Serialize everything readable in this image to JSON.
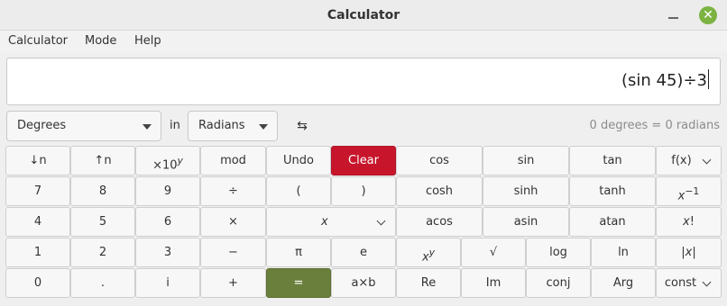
{
  "window": {
    "title": "Calculator",
    "close_glyph": "✕"
  },
  "menu": {
    "items": [
      "Calculator",
      "Mode",
      "Help"
    ]
  },
  "display": {
    "expression": "(sin 45)÷3"
  },
  "conversion": {
    "from_unit": "Degrees",
    "in_label": "in",
    "to_unit": "Radians",
    "swap_glyph": "⇆",
    "result": "0 degrees = 0 radians"
  },
  "keys": {
    "down_n": "↓n",
    "up_n": "↑n",
    "exp10_base": "×10",
    "exp10_sup": "y",
    "mod": "mod",
    "undo": "Undo",
    "clear": "Clear",
    "cos": "cos",
    "sin": "sin",
    "tan": "tan",
    "fx": "f(x)",
    "d7": "7",
    "d8": "8",
    "d9": "9",
    "divide": "÷",
    "lparen": "(",
    "rparen": ")",
    "cosh": "cosh",
    "sinh": "sinh",
    "tanh": "tanh",
    "inv_base": "x",
    "inv_sup": "−1",
    "d4": "4",
    "d5": "5",
    "d6": "6",
    "multiply": "×",
    "var_x": "x",
    "acos": "acos",
    "asin": "asin",
    "atan": "atan",
    "factorial_x": "x",
    "factorial_bang": "!",
    "d1": "1",
    "d2": "2",
    "d3": "3",
    "minus": "−",
    "pi": "π",
    "e": "e",
    "pow_base": "x",
    "pow_sup": "y",
    "sqrt": "√",
    "log": "log",
    "ln": "ln",
    "abs_left": "|",
    "abs_x": "x",
    "abs_right": "|",
    "d0": "0",
    "point": ".",
    "imag": "i",
    "plus": "+",
    "equals": "=",
    "bitwise_and": "a×b",
    "re": "Re",
    "im": "Im",
    "conj": "conj",
    "arg": "Arg",
    "const": "const"
  }
}
